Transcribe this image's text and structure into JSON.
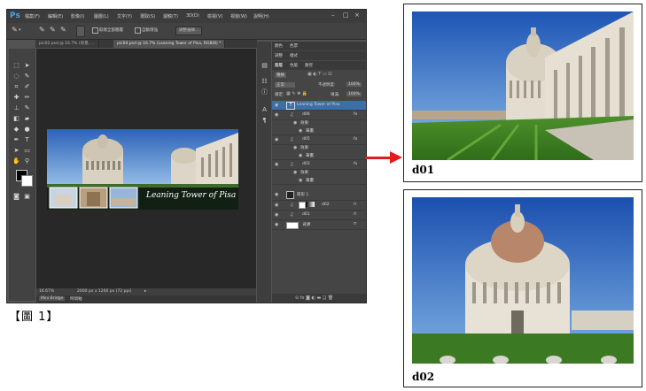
{
  "photoshop": {
    "logo": "Ps",
    "menu": [
      "檔案(F)",
      "編輯(E)",
      "影像(I)",
      "圖層(L)",
      "文字(Y)",
      "選取(S)",
      "濾鏡(T)",
      "3D(D)",
      "檢視(V)",
      "視窗(W)",
      "說明(H)"
    ],
    "window_controls": [
      "–",
      "□",
      "×"
    ],
    "options_bar": {
      "sample_all_layers": "取樣全部圖層",
      "auto_enhance": "自動增強",
      "refine_edge": "調整邊緣..."
    },
    "tabs": [
      {
        "label": "pic02.psd @ 16.7% (背景, ...",
        "active": false
      },
      {
        "label": "pic04.psd @ 16.7% (Leaning Tower of Pisa, RGB/8) *",
        "active": true
      }
    ],
    "document": {
      "overlay_text": "Leaning Tower of Pisa"
    },
    "status": {
      "zoom": "16.67%",
      "doc_info": "2000 px x 1200 px (72 ppi)"
    },
    "bridge_tabs": [
      "Mini Bridge",
      "時間軸"
    ],
    "panels": {
      "tabs_row1": [
        "顏色",
        "色票"
      ],
      "tabs_row2": [
        "調整",
        "樣式"
      ],
      "tabs_row3": [
        "圖層",
        "色版",
        "路徑"
      ],
      "kind_filter": "種類",
      "blend_mode": "正常",
      "opacity_label": "不透明度:",
      "opacity_value": "100%",
      "lock_label": "鎖定:",
      "fill_label": "填滿:",
      "fill_value": "100%",
      "layers": [
        {
          "name": "Leaning Tower of Pisa",
          "kind": "text",
          "selected": true
        },
        {
          "name": "d06",
          "kind": "smart",
          "fx": true
        },
        {
          "name": "效果",
          "kind": "effect-group",
          "indent": 1
        },
        {
          "name": "筆畫",
          "kind": "effect",
          "indent": 2
        },
        {
          "name": "d05",
          "kind": "smart",
          "fx": true
        },
        {
          "name": "效果",
          "kind": "effect-group",
          "indent": 1
        },
        {
          "name": "筆畫",
          "kind": "effect",
          "indent": 2
        },
        {
          "name": "d03",
          "kind": "smart",
          "fx": true
        },
        {
          "name": "效果",
          "kind": "effect-group",
          "indent": 1
        },
        {
          "name": "筆畫",
          "kind": "effect",
          "indent": 2
        },
        {
          "name": "矩形 1",
          "kind": "shape"
        },
        {
          "name": "d02",
          "kind": "smart-masked"
        },
        {
          "name": "d01",
          "kind": "smart"
        },
        {
          "name": "背景",
          "kind": "background"
        }
      ]
    }
  },
  "figure_caption": "【圖 1】",
  "photos": [
    {
      "label": "d01"
    },
    {
      "label": "d02"
    }
  ],
  "colors": {
    "arrow": "#e31b1b",
    "ps_bg": "#535353",
    "selected_layer": "#3c6fa8"
  }
}
